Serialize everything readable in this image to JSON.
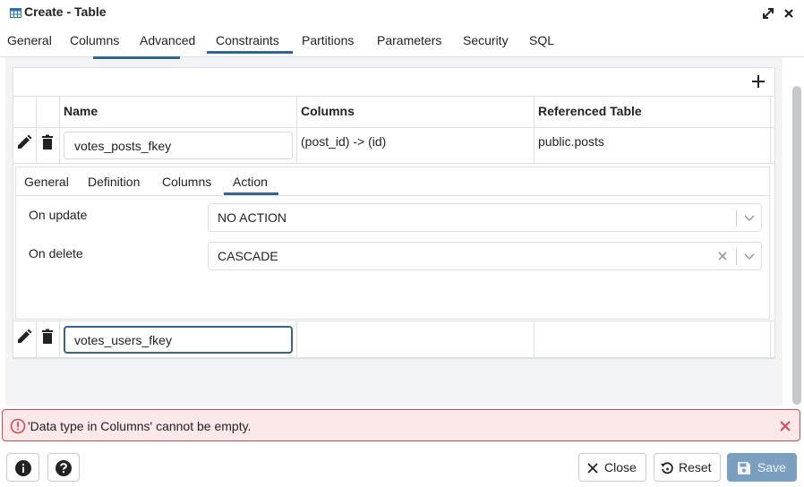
{
  "window": {
    "title": "Create - Table"
  },
  "tabs": [
    "General",
    "Columns",
    "Advanced",
    "Constraints",
    "Partitions",
    "Parameters",
    "Security",
    "SQL"
  ],
  "active_tab": "Constraints",
  "grid": {
    "headers": [
      "Name",
      "Columns",
      "Referenced Table"
    ],
    "rows": [
      {
        "name": "votes_posts_fkey",
        "columns": "(post_id) -> (id)",
        "referenced_table": "public.posts"
      },
      {
        "name": "votes_users_fkey",
        "columns": "",
        "referenced_table": ""
      }
    ]
  },
  "detail": {
    "tabs": [
      "General",
      "Definition",
      "Columns",
      "Action"
    ],
    "active_tab": "Action",
    "on_update": {
      "label": "On update",
      "value": "NO ACTION"
    },
    "on_delete": {
      "label": "On delete",
      "value": "CASCADE"
    }
  },
  "error": {
    "message": "'Data type in Columns' cannot be empty."
  },
  "footer": {
    "close": "Close",
    "reset": "Reset",
    "save": "Save"
  },
  "colors": {
    "accent": "#326690",
    "error_border": "#d84a53",
    "error_bg": "#fbe8e9",
    "save_disabled": "#7a9fbf"
  },
  "icons": [
    "table-icon",
    "expand-icon",
    "close-icon",
    "plus-icon",
    "pencil-icon",
    "trash-icon",
    "chevron-down-icon",
    "clear-icon",
    "alert-circle-icon",
    "info-icon",
    "help-icon",
    "reset-icon",
    "save-icon"
  ]
}
